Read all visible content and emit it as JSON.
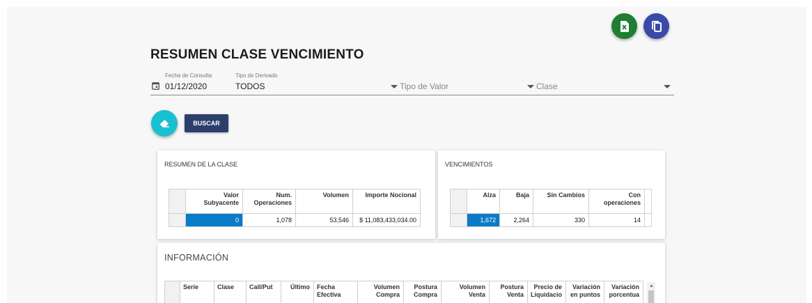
{
  "title": "RESUMEN CLASE VENCIMIENTO",
  "colors": {
    "excel": "#1e7e34",
    "copy": "#3a4aa8",
    "clear": "#19c0cf",
    "buscar": "#2c3e6b",
    "selected": "#0a7bc7"
  },
  "icons": {
    "excel": "excel-file-icon",
    "copy": "copy-icon",
    "clear": "eraser-icon",
    "calendar": "calendar-icon"
  },
  "filters": {
    "fecha": {
      "label": "Fecha de Consulta",
      "value": "01/12/2020"
    },
    "derivado": {
      "label": "Tipo de Derivado",
      "value": "TODOS"
    },
    "tipo_valor": {
      "placeholder": "Tipo de Valor"
    },
    "clase": {
      "placeholder": "Clase"
    }
  },
  "buscar_label": "BUSCAR",
  "resumen": {
    "title": "RESUMEN DE LA CLASE",
    "headers": [
      "Valor Subyacente",
      "Num. Operaciones",
      "Volumen",
      "Importe Nocional"
    ],
    "rows": [
      [
        "0",
        "1,078",
        "53,546",
        "$ 11,083,433,034.00"
      ]
    ]
  },
  "vencimientos": {
    "title": "VENCIMIENTOS",
    "headers": [
      "Alza",
      "Baja",
      "Sin Cambios",
      "Con operaciones"
    ],
    "rows": [
      [
        "1,672",
        "2,264",
        "330",
        "14"
      ]
    ]
  },
  "informacion": {
    "title": "INFORMACIÓN",
    "headers": [
      "Serie",
      "Clase",
      "Call/Put",
      "Último",
      "Fecha Efectiva",
      "Volumen Compra",
      "Postura Compra",
      "Volumen Venta",
      "Postura Venta",
      "Precio de Liquidacio",
      "Variación en puntos",
      "Variación porcentua"
    ]
  }
}
